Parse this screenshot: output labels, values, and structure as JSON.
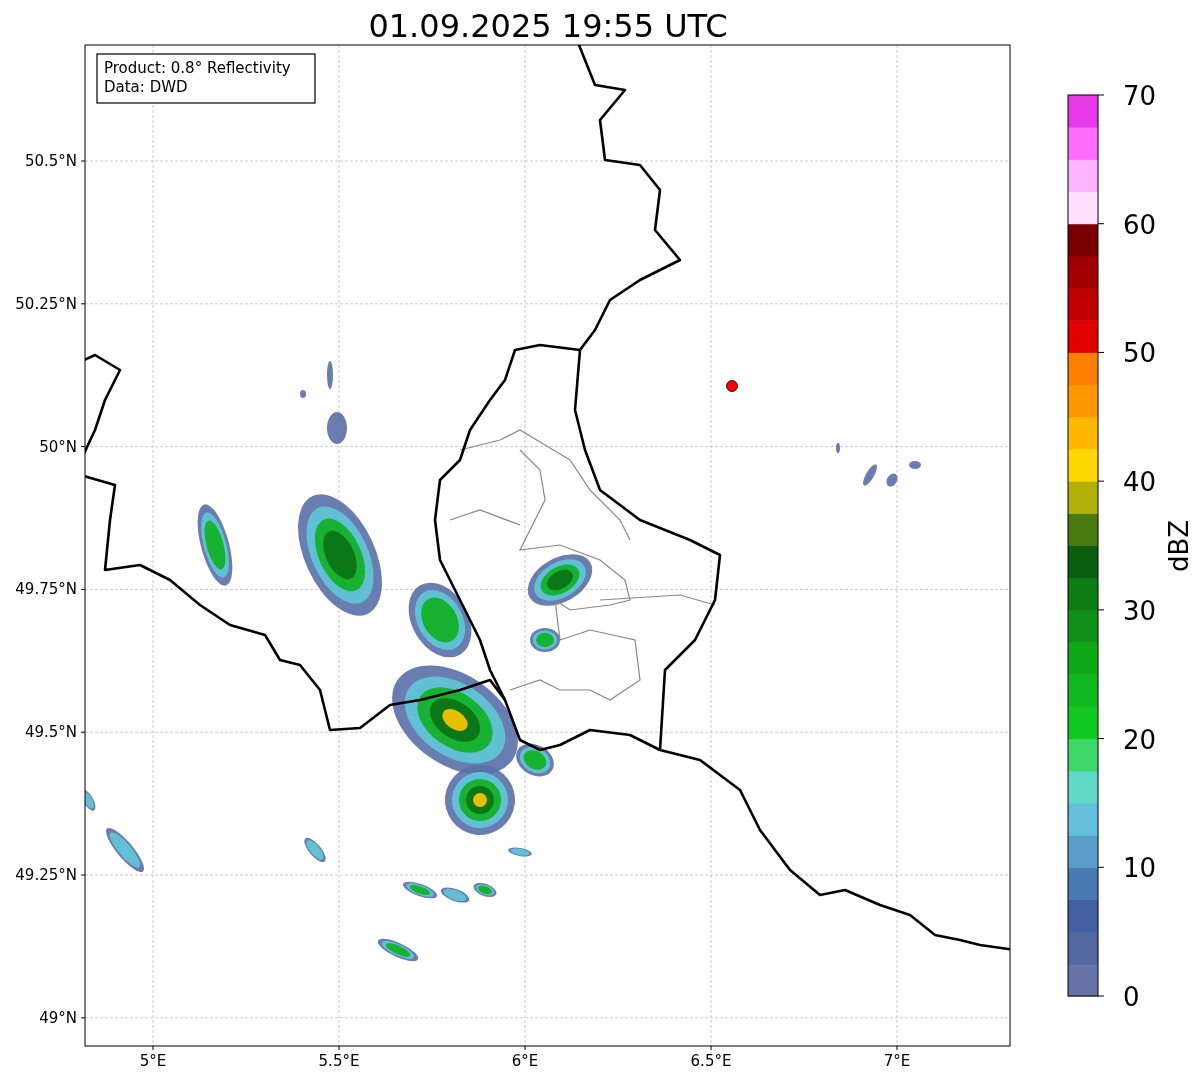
{
  "title": "01.09.2025 19:55 UTC",
  "info_box": {
    "lines": [
      "Product: 0.8° Reflectivity",
      "Data: DWD"
    ]
  },
  "map": {
    "lon_ticks": [
      "5°E",
      "5.5°E",
      "6°E",
      "6.5°E",
      "7°E"
    ],
    "lat_ticks": [
      "50.5°N",
      "50.25°N",
      "50°N",
      "49.75°N",
      "49.5°N",
      "49.25°N",
      "49°N"
    ]
  },
  "colorbar": {
    "label": "dBZ",
    "ticks": [
      "70",
      "60",
      "50",
      "40",
      "30",
      "20",
      "10",
      "0"
    ],
    "segments": [
      {
        "color": "#6674a8"
      },
      {
        "color": "#52679f"
      },
      {
        "color": "#4360a2"
      },
      {
        "color": "#4a7ab2"
      },
      {
        "color": "#5a9dc8"
      },
      {
        "color": "#64c0dc"
      },
      {
        "color": "#60d8c8"
      },
      {
        "color": "#3ed86a"
      },
      {
        "color": "#10c820"
      },
      {
        "color": "#10b820"
      },
      {
        "color": "#10a818"
      },
      {
        "color": "#0e9016"
      },
      {
        "color": "#0e7e14"
      },
      {
        "color": "#0a5e0e"
      },
      {
        "color": "#487a10"
      },
      {
        "color": "#b0b008"
      },
      {
        "color": "#ffd800"
      },
      {
        "color": "#ffb800"
      },
      {
        "color": "#ff9800"
      },
      {
        "color": "#ff8000"
      },
      {
        "color": "#e00000"
      },
      {
        "color": "#c00000"
      },
      {
        "color": "#a00000"
      },
      {
        "color": "#780000"
      },
      {
        "color": "#ffe0ff"
      },
      {
        "color": "#ffb4ff"
      },
      {
        "color": "#ff6cff"
      },
      {
        "color": "#e838e8"
      }
    ]
  }
}
